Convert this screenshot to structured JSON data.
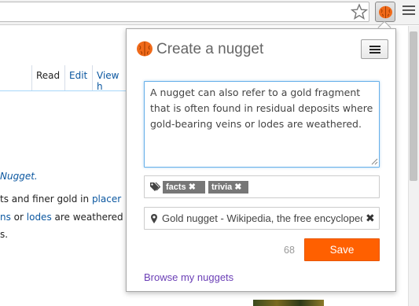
{
  "popup": {
    "title": "Create a nugget",
    "note_text": "A nugget can also refer to a gold fragment that is often found in residual deposits where gold-bearing veins or lodes are weathered.",
    "tags": [
      {
        "label": "facts"
      },
      {
        "label": "trivia"
      }
    ],
    "tag_remove_glyph": "✖",
    "source": "Gold nugget - Wikipedia, the free encyclopedia",
    "source_remove_glyph": "✖",
    "char_count": "68",
    "save_label": "Save",
    "browse_link": "Browse my nuggets",
    "accent_color": "#ff6000",
    "link_color": "#6b3fb6"
  },
  "wiki": {
    "tabs": {
      "read": "Read",
      "edit": "Edit",
      "view": "View h"
    },
    "line1": "Nugget.",
    "line2_a": "ts and finer gold in ",
    "line2_link": "placer",
    "line3_link_a": "ns",
    "line3_mid": " or ",
    "line3_link_b": "lodes",
    "line3_end": " are weathered",
    "line4": "s.",
    "link_color": "#0b57a0"
  },
  "icons": {
    "star": "star-icon",
    "extension": "brain-icon",
    "menu": "hamburger-icon",
    "tag": "tag-icon",
    "location": "map-pin-icon"
  }
}
